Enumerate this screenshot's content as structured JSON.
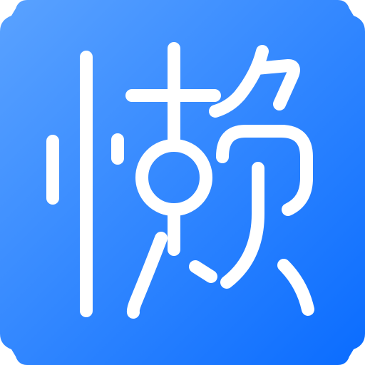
{
  "app_icon": {
    "glyph": "懒",
    "glyph_is_logo": true,
    "colors": {
      "gradient_light": "#5aa2ff",
      "gradient_dark": "#0a6cff",
      "glyph": "#ffffff",
      "background": "#ffffff"
    }
  }
}
